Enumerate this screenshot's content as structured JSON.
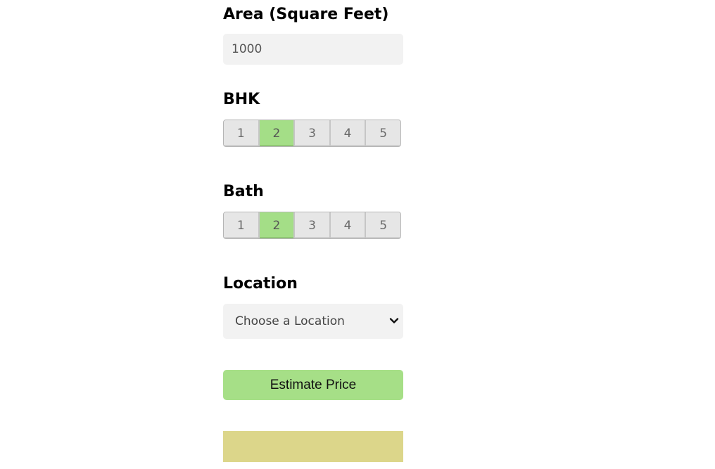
{
  "area": {
    "label": "Area (Square Feet)",
    "value": "1000",
    "placeholder": ""
  },
  "bhk": {
    "label": "BHK",
    "options": [
      "1",
      "2",
      "3",
      "4",
      "5"
    ],
    "selected": "2"
  },
  "bath": {
    "label": "Bath",
    "options": [
      "1",
      "2",
      "3",
      "4",
      "5"
    ],
    "selected": "2"
  },
  "location": {
    "label": "Location",
    "selected_value": "Choose a Location"
  },
  "estimate_button": {
    "label": "Estimate Price"
  },
  "result": {
    "text": ""
  },
  "colors": {
    "selected_segment": "#a4de87",
    "button": "#a6df87",
    "result_panel": "#dcd68a",
    "input_background": "#f2f2f2"
  },
  "icons": {
    "select_arrow": "chevron-down-icon"
  }
}
